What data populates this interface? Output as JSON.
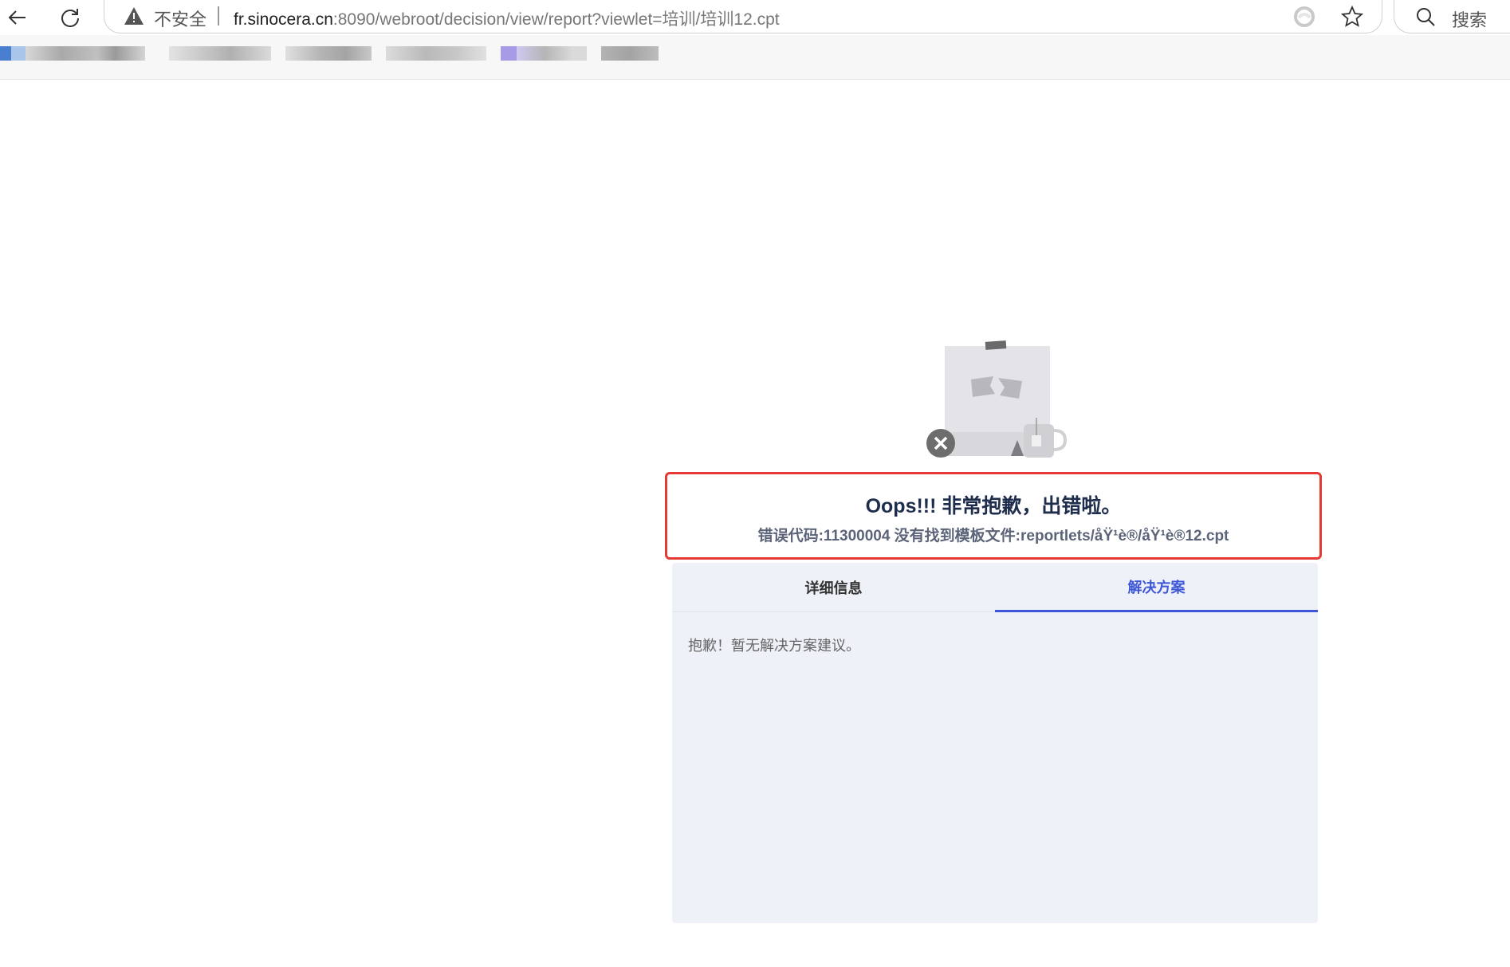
{
  "browser": {
    "insecure_label": "不安全",
    "url_host": "fr.sinocera.cn",
    "url_rest": ":8090/webroot/decision/view/report?viewlet=培训/培训12.cpt",
    "search_label": "搜索"
  },
  "error": {
    "title": "Oops!!! 非常抱歉，出错啦。",
    "detail": "错误代码:11300004 没有找到模板文件:reportlets/åŸ¹è®/åŸ¹è®12.cpt"
  },
  "tabs": {
    "details_label": "详细信息",
    "solution_label": "解决方案",
    "active": "solution"
  },
  "solution_text": "抱歉！暂无解决方案建议。",
  "colors": {
    "error_border": "#e53935",
    "accent": "#3d57d8",
    "panel_bg": "#eef1f7"
  }
}
